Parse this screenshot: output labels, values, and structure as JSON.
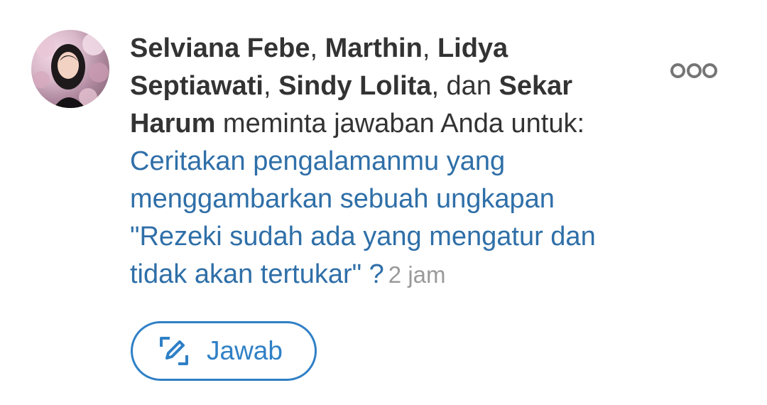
{
  "notification": {
    "avatar_icon": "user-avatar-photo",
    "requesters": {
      "name1": "Selviana Febe",
      "sep1": ", ",
      "name2": "Marthin",
      "sep2": ", ",
      "name3": "Lidya Septiawati",
      "sep3": ", ",
      "name4": "Sindy Lolita",
      "sep4": ", dan ",
      "name5": "Sekar Harum"
    },
    "action_text": " meminta jawaban Anda untuk:",
    "question": "Ceritakan pengalamanmu yang menggambarkan sebuah ungkapan \"Rezeki sudah ada yang mengatur dan tidak akan tertukar\" ?",
    "timestamp": "2 jam",
    "more_icon": "more-options-icon",
    "answer_button": {
      "icon": "edit-icon",
      "label": "Jawab"
    },
    "colors": {
      "question_link": "#2f6fa8",
      "accent": "#2f80c6",
      "timestamp": "#9a9a9a",
      "text": "#333333"
    }
  }
}
